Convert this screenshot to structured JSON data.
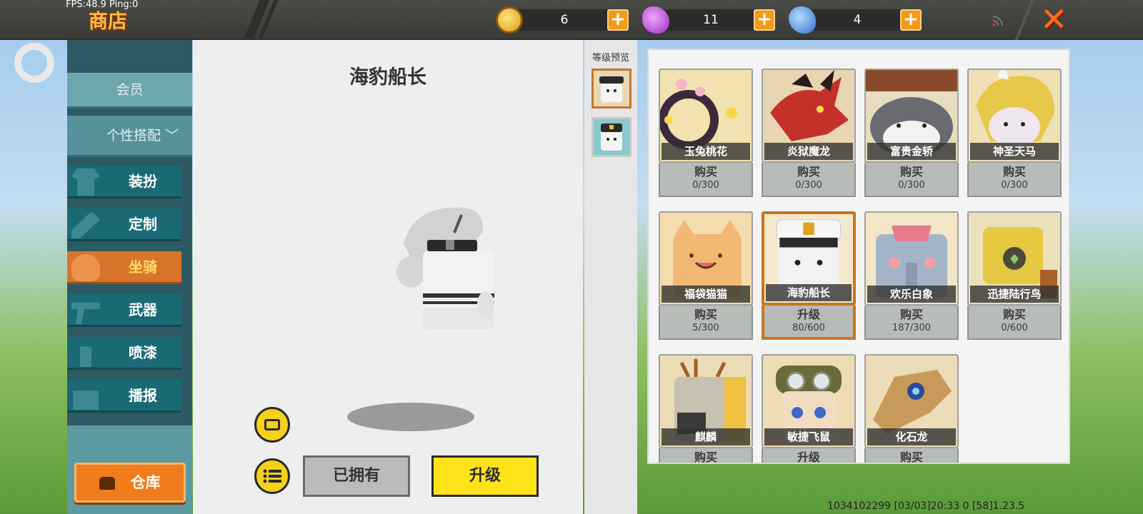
{
  "debug": {
    "fps": "FPS:48.9  Ping:0"
  },
  "header": {
    "title": "商店",
    "currencies": [
      {
        "icon": "gold-coin-icon",
        "value": "6",
        "color": "#e6b52a"
      },
      {
        "icon": "purple-gem-icon",
        "value": "11",
        "color": "#b44ad0"
      },
      {
        "icon": "blue-gem-icon",
        "value": "4",
        "color": "#4a8ce0"
      }
    ],
    "plus_label": "+",
    "close_label": "✕"
  },
  "sidebar": {
    "items": [
      {
        "label": "会员",
        "kind": "head"
      },
      {
        "label": "个性搭配",
        "kind": "head"
      },
      {
        "label": "装扮",
        "kind": "item",
        "icon": "shirt-icon"
      },
      {
        "label": "定制",
        "kind": "item",
        "icon": "pencil-icon"
      },
      {
        "label": "坐骑",
        "kind": "item",
        "icon": "saddle-icon",
        "active": true
      },
      {
        "label": "武器",
        "kind": "item",
        "icon": "gun-icon"
      },
      {
        "label": "喷漆",
        "kind": "item",
        "icon": "spray-can-icon"
      },
      {
        "label": "播报",
        "kind": "item",
        "icon": "gift-box-icon"
      }
    ],
    "expand_icon": "﹀",
    "warehouse_label": "仓库"
  },
  "preview": {
    "name": "海豹船长",
    "owned_label": "已拥有",
    "upgrade_label": "升级",
    "level_preview_title": "等级预览"
  },
  "mounts": [
    {
      "name": "玉兔桃花",
      "action": "购买",
      "progress": "0/300",
      "bg": "#f2e2b0"
    },
    {
      "name": "炎狱魔龙",
      "action": "购买",
      "progress": "0/300",
      "bg": "#e8d6b2"
    },
    {
      "name": "富贵金轿",
      "action": "购买",
      "progress": "0/300",
      "bg": "#e8dcc0"
    },
    {
      "name": "神圣天马",
      "action": "购买",
      "progress": "0/300",
      "bg": "#efe0b6"
    },
    {
      "name": "福袋猫猫",
      "action": "购买",
      "progress": "5/300",
      "bg": "#f4dcae"
    },
    {
      "name": "海豹船长",
      "action": "升级",
      "progress": "80/600",
      "bg": "#f4e8cc",
      "selected": true
    },
    {
      "name": "欢乐白象",
      "action": "购买",
      "progress": "187/300",
      "bg": "#f2e6c6"
    },
    {
      "name": "迅捷陆行鸟",
      "action": "购买",
      "progress": "0/600",
      "bg": "#ece0ba"
    },
    {
      "name": "麒麟",
      "action": "购买",
      "progress": "",
      "bg": "#ecdcb6"
    },
    {
      "name": "敏捷飞鼠",
      "action": "升级",
      "progress": "",
      "bg": "#eedcb4"
    },
    {
      "name": "化石龙",
      "action": "购买",
      "progress": "",
      "bg": "#ecdcb8"
    }
  ],
  "footer": {
    "info": "1034102299    [03/03]20:33 0   [58]1.23.5"
  }
}
